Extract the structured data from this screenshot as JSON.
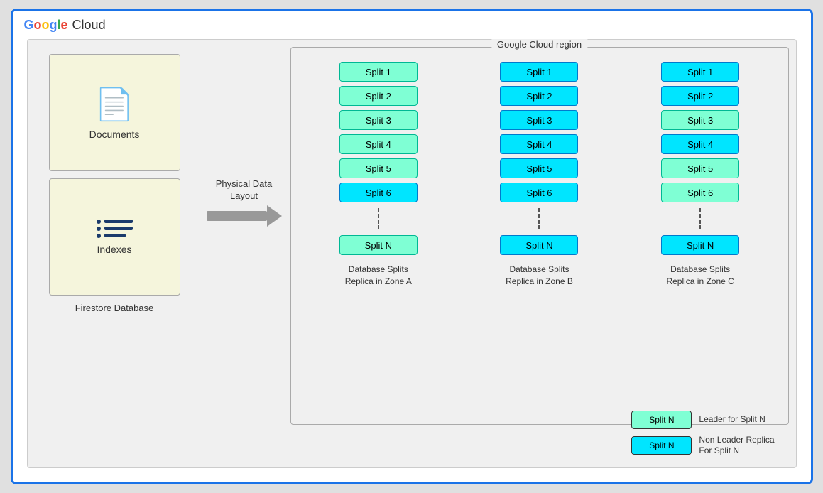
{
  "header": {
    "google_text": "Google",
    "cloud_text": "Cloud"
  },
  "region": {
    "label": "Google Cloud region"
  },
  "left_panel": {
    "documents_label": "Documents",
    "indexes_label": "Indexes",
    "firestore_label": "Firestore Database"
  },
  "arrow": {
    "label": "Physical Data Layout"
  },
  "zones": [
    {
      "name": "zone-a",
      "splits": [
        "Split 1",
        "Split 2",
        "Split 3",
        "Split 4",
        "Split 5",
        "Split 6",
        "Split N"
      ],
      "label": "Database Splits\nReplica in Zone A",
      "style": [
        "green",
        "green",
        "green",
        "green",
        "green",
        "cyan",
        "green"
      ]
    },
    {
      "name": "zone-b",
      "splits": [
        "Split 1",
        "Split 2",
        "Split 3",
        "Split 4",
        "Split 5",
        "Split 6",
        "Split N"
      ],
      "label": "Database Splits\nReplica in Zone B",
      "style": [
        "cyan",
        "cyan",
        "cyan",
        "cyan",
        "cyan",
        "cyan",
        "cyan"
      ]
    },
    {
      "name": "zone-c",
      "splits": [
        "Split 1",
        "Split 2",
        "Split 3",
        "Split 4",
        "Split 5",
        "Split 6",
        "Split N"
      ],
      "label": "Database Splits\nReplica in Zone C",
      "style": [
        "cyan",
        "cyan",
        "green",
        "cyan",
        "green",
        "green",
        "cyan"
      ]
    }
  ],
  "legend": [
    {
      "chip_label": "Split N",
      "description": "Leader for Split N",
      "chip_style": "green"
    },
    {
      "chip_label": "Split N",
      "description": "Non Leader Replica\nFor Split N",
      "chip_style": "cyan"
    }
  ]
}
